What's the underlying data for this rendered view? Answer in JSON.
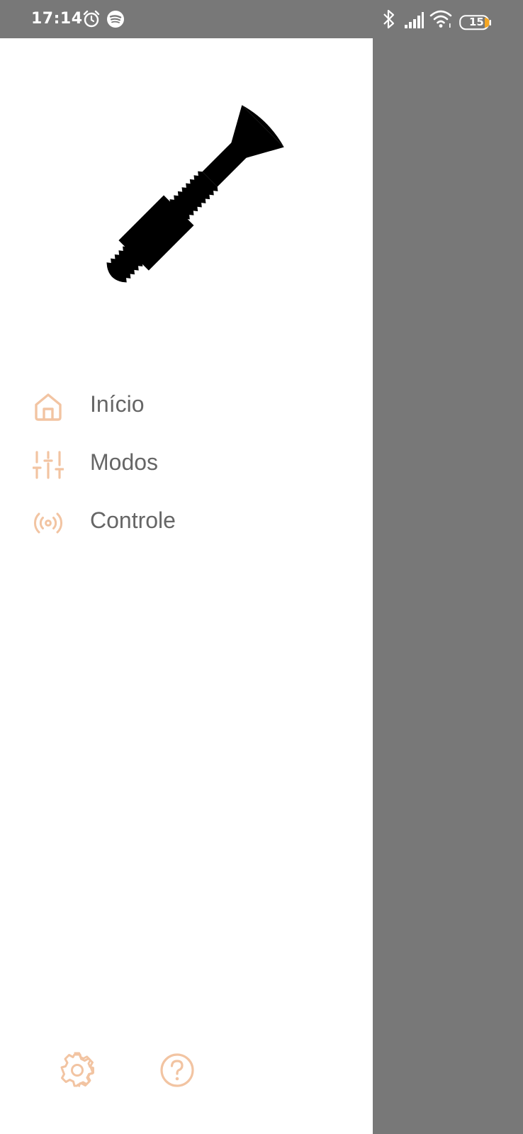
{
  "status_bar": {
    "time": "17:14",
    "battery_level": "15",
    "icons": [
      "alarm-icon",
      "spotify-icon",
      "bluetooth-icon",
      "signal-icon",
      "wifi-icon",
      "battery-icon"
    ]
  },
  "drawer": {
    "logo": "screw-logo",
    "menu": [
      {
        "label": "Início",
        "icon": "home-icon"
      },
      {
        "label": "Modos",
        "icon": "sliders-icon"
      },
      {
        "label": "Controle",
        "icon": "broadcast-icon"
      }
    ],
    "footer": [
      {
        "icon": "gear-icon"
      },
      {
        "icon": "help-icon"
      }
    ]
  },
  "colors": {
    "accent": "#f2c4a2",
    "label": "#666666",
    "scrim": "#787878",
    "drawer_bg": "#ffffff"
  }
}
